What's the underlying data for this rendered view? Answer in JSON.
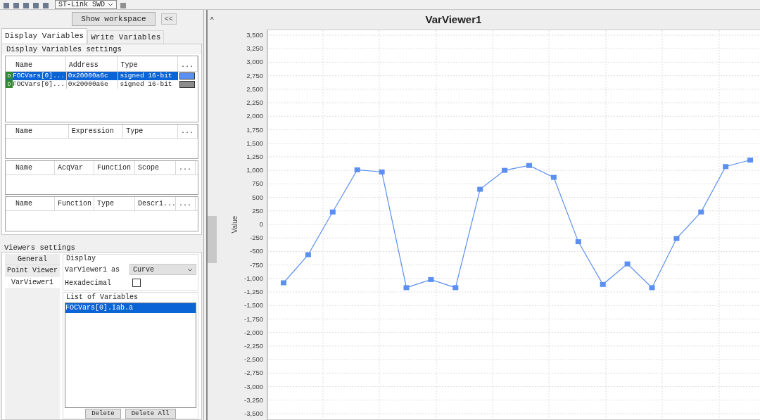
{
  "toolbar": {
    "probe": "ST-Link SWD"
  },
  "workspace_button": "Show workspace",
  "collapse_button": "<<",
  "tabs": [
    {
      "label": "Display Variables",
      "selected": true
    },
    {
      "label": "Write Variables",
      "selected": false
    }
  ],
  "display_settings": {
    "title": "Display Variables settings",
    "columns": [
      "Name",
      "Address",
      "Type",
      "..."
    ],
    "rows": [
      {
        "badge": "D",
        "name": "FOCVars[0]...",
        "address": "0x20000a6c",
        "type": "signed 16-bit",
        "color": "#5b8ff0",
        "selected": true
      },
      {
        "badge": "D",
        "name": "FOCVars[0]...",
        "address": "0x20000a6e",
        "type": "signed 16-bit",
        "color": "#8c8c8c",
        "selected": false
      }
    ],
    "tables": [
      {
        "columns": [
          "Name",
          "Expression",
          "Type",
          "..."
        ]
      },
      {
        "columns": [
          "Name",
          "AcqVar",
          "Function",
          "Scope",
          "..."
        ]
      },
      {
        "columns": [
          "Name",
          "Function",
          "Type",
          "Descri...",
          "..."
        ]
      }
    ]
  },
  "viewers_settings": {
    "title": "Viewers settings",
    "viewers": [
      {
        "label": "General",
        "selected": false
      },
      {
        "label": "Point Viewer",
        "selected": false
      },
      {
        "label": "VarViewer1",
        "selected": true
      }
    ],
    "display": {
      "title": "Display",
      "as_label": "VarViewer1 as",
      "as_value": "Curve",
      "hex_label": "Hexadecimal",
      "hex_checked": false
    },
    "list": {
      "title": "List of Variables",
      "items": [
        {
          "label": "FOCVars[0].Iab.a",
          "selected": true
        }
      ]
    },
    "buttons": [
      "Delete",
      "Delete All"
    ]
  },
  "viewer": {
    "collapse": "^",
    "chart_data": {
      "type": "line",
      "grid": true,
      "title": "VarViewer1",
      "ylabel": "Value",
      "ylim": [
        -3500,
        3500
      ],
      "yticks": [
        {
          "value": 3500,
          "label": "3,500"
        },
        {
          "value": 3250,
          "label": "3,250"
        },
        {
          "value": 3000,
          "label": "3,000"
        },
        {
          "value": 2750,
          "label": "2,750"
        },
        {
          "value": 2500,
          "label": "2,500"
        },
        {
          "value": 2250,
          "label": "2,250"
        },
        {
          "value": 2000,
          "label": "2,000"
        },
        {
          "value": 1750,
          "label": "1,750"
        },
        {
          "value": 1500,
          "label": "1,500"
        },
        {
          "value": 1250,
          "label": "1,250"
        },
        {
          "value": 1000,
          "label": "1,000"
        },
        {
          "value": 750,
          "label": "750"
        },
        {
          "value": 500,
          "label": "500"
        },
        {
          "value": 250,
          "label": "250"
        },
        {
          "value": 0,
          "label": "0"
        },
        {
          "value": -250,
          "label": "-250"
        },
        {
          "value": -500,
          "label": "-500"
        },
        {
          "value": -750,
          "label": "-750"
        },
        {
          "value": -1000,
          "label": "-1,000"
        },
        {
          "value": -1250,
          "label": "-1,250"
        },
        {
          "value": -1500,
          "label": "-1,500"
        },
        {
          "value": -1750,
          "label": "-1,750"
        },
        {
          "value": -2000,
          "label": "-2,000"
        },
        {
          "value": -2250,
          "label": "-2,250"
        },
        {
          "value": -2500,
          "label": "-2,500"
        },
        {
          "value": -2750,
          "label": "-2,750"
        },
        {
          "value": -3000,
          "label": "-3,000"
        },
        {
          "value": -3250,
          "label": "-3,250"
        },
        {
          "value": -3500,
          "label": "-3,500"
        }
      ],
      "series": [
        {
          "color": "#5b8ff0",
          "marker": "square",
          "values": [
            -1080,
            -560,
            230,
            1010,
            970,
            -1170,
            -1020,
            -1170,
            650,
            1000,
            1090,
            870,
            -320,
            -1110,
            -730,
            -1170,
            -260,
            230,
            1070,
            1190
          ]
        }
      ]
    }
  }
}
